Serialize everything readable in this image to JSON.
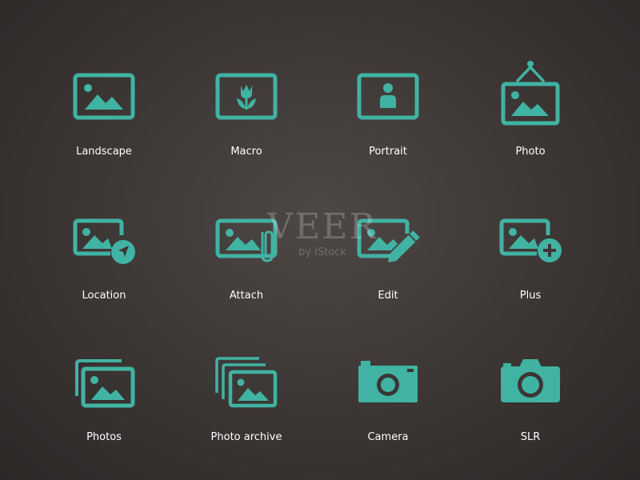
{
  "accent_color": "#41b3a3",
  "background_color": "#3b3634",
  "icons": [
    {
      "label": "Landscape",
      "icon": "landscape-icon"
    },
    {
      "label": "Macro",
      "icon": "macro-icon"
    },
    {
      "label": "Portrait",
      "icon": "portrait-icon"
    },
    {
      "label": "Photo",
      "icon": "hanging-photo-icon"
    },
    {
      "label": "Location",
      "icon": "photo-location-icon"
    },
    {
      "label": "Attach",
      "icon": "photo-attach-icon"
    },
    {
      "label": "Edit",
      "icon": "photo-edit-icon"
    },
    {
      "label": "Plus",
      "icon": "photo-plus-icon"
    },
    {
      "label": "Photos",
      "icon": "photos-stack-icon"
    },
    {
      "label": "Photo archive",
      "icon": "photo-archive-icon"
    },
    {
      "label": "Camera",
      "icon": "camera-icon"
    },
    {
      "label": "SLR",
      "icon": "slr-camera-icon"
    }
  ],
  "watermark": {
    "brand": "VEER",
    "sub": "by iStock"
  }
}
